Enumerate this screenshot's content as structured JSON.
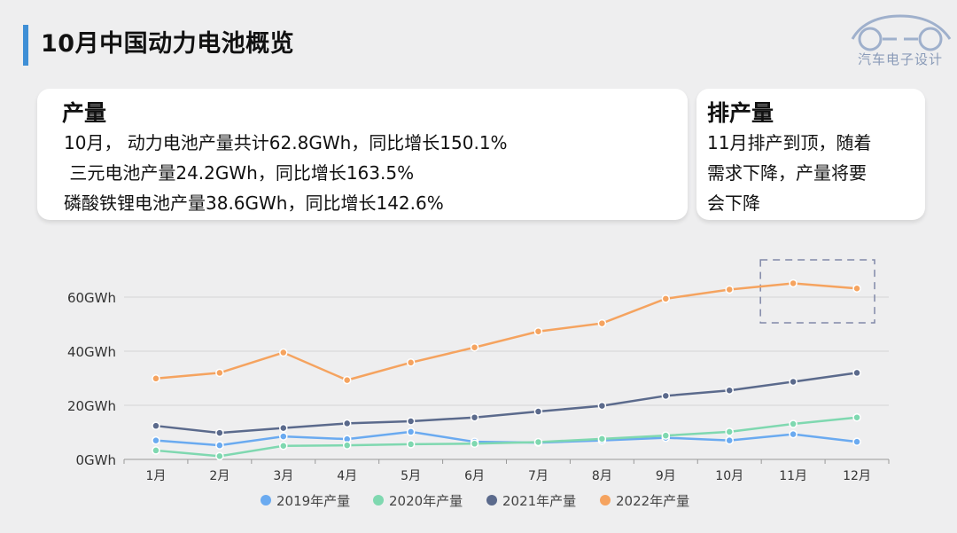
{
  "header": {
    "title": "10月中国动力电池概览",
    "logo_text": "汽车电子设计"
  },
  "cards": {
    "production": {
      "title": "产量",
      "lines": [
        "10月， 动力电池产量共计62.8GWh，同比增长150.1%",
        " 三元电池产量24.2GWh，同比增长163.5%",
        "磷酸铁锂电池产量38.6GWh，同比增长142.6%"
      ]
    },
    "schedule": {
      "title": "排产量",
      "lines": [
        "11月排产到顶，随着",
        "需求下降，产量将要",
        "会下降"
      ]
    }
  },
  "colors": {
    "2019": "#6aaaf0",
    "2020": "#7fd8b0",
    "2021": "#5b6a8c",
    "2022": "#f5a35f",
    "accent": "#3f8fd6"
  },
  "chart_data": {
    "type": "line",
    "categories": [
      "1月",
      "2月",
      "3月",
      "4月",
      "5月",
      "6月",
      "7月",
      "8月",
      "9月",
      "10月",
      "11月",
      "12月"
    ],
    "y_tick_labels": [
      "0GWh",
      "20GWh",
      "40GWh",
      "60GWh"
    ],
    "y_ticks": [
      0,
      20,
      40,
      60
    ],
    "ylim": [
      0,
      68
    ],
    "grid": true,
    "legend_position": "bottom",
    "series": [
      {
        "name": "2019年产量",
        "color": "#6aaaf0",
        "values": [
          7.0,
          5.2,
          8.5,
          7.5,
          10.2,
          6.5,
          6.2,
          7.0,
          8.0,
          7.0,
          9.3,
          6.5
        ]
      },
      {
        "name": "2020年产量",
        "color": "#7fd8b0",
        "values": [
          3.3,
          1.2,
          5.0,
          5.2,
          5.6,
          5.8,
          6.4,
          7.6,
          8.8,
          10.2,
          13.1,
          15.5
        ]
      },
      {
        "name": "2021年产量",
        "color": "#5b6a8c",
        "values": [
          12.4,
          9.8,
          11.6,
          13.3,
          14.1,
          15.5,
          17.7,
          19.8,
          23.5,
          25.5,
          28.7,
          32.0
        ]
      },
      {
        "name": "2022年产量",
        "color": "#f5a35f",
        "values": [
          29.9,
          32.0,
          39.5,
          29.3,
          35.8,
          41.4,
          47.3,
          50.3,
          59.4,
          62.8,
          65.1,
          63.2
        ]
      }
    ],
    "highlight_categories": [
      "11月",
      "12月"
    ]
  }
}
